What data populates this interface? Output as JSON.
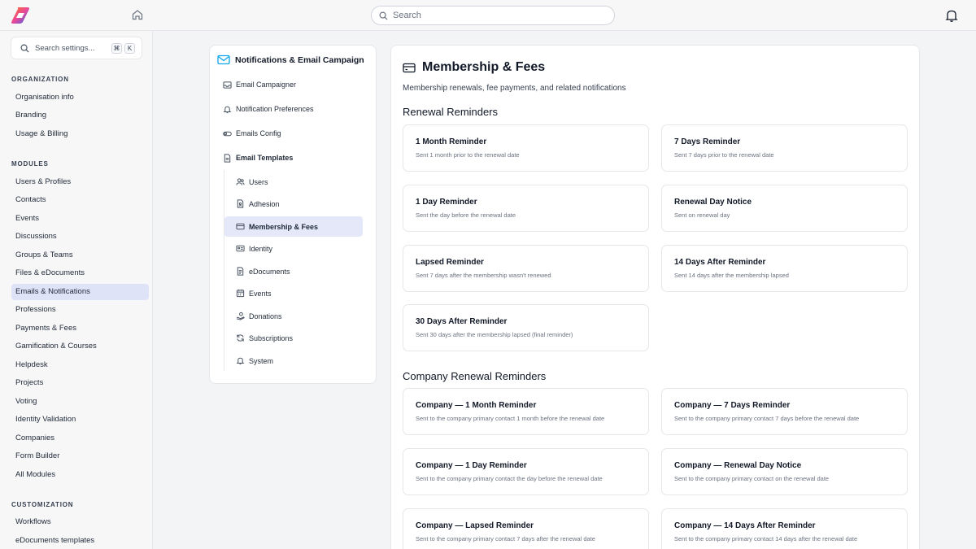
{
  "topbar": {
    "search_placeholder": "Search"
  },
  "sidebar": {
    "search_placeholder": "Search settings...",
    "shortcut_keys": [
      "⌘",
      "K"
    ],
    "sections": [
      {
        "title": "ORGANIZATION",
        "items": [
          {
            "label": "Organisation info"
          },
          {
            "label": "Branding"
          },
          {
            "label": "Usage & Billing"
          }
        ]
      },
      {
        "title": "MODULES",
        "items": [
          {
            "label": "Users & Profiles"
          },
          {
            "label": "Contacts"
          },
          {
            "label": "Events"
          },
          {
            "label": "Discussions"
          },
          {
            "label": "Groups & Teams"
          },
          {
            "label": "Files & eDocuments"
          },
          {
            "label": "Emails & Notifications"
          },
          {
            "label": "Professions"
          },
          {
            "label": "Payments & Fees"
          },
          {
            "label": "Gamification & Courses"
          },
          {
            "label": "Helpdesk"
          },
          {
            "label": "Projects"
          },
          {
            "label": "Voting"
          },
          {
            "label": "Identity Validation"
          },
          {
            "label": "Companies"
          },
          {
            "label": "Form Builder"
          },
          {
            "label": "All Modules"
          }
        ]
      },
      {
        "title": "CUSTOMIZATION",
        "items": [
          {
            "label": "Workflows"
          },
          {
            "label": "eDocuments templates"
          }
        ]
      }
    ],
    "active_item": "Emails & Notifications"
  },
  "subnav": {
    "title": "Notifications & Email Campaign",
    "items": [
      {
        "label": "Email Campaigner",
        "icon": "inbox-icon"
      },
      {
        "label": "Notification Preferences",
        "icon": "bell-icon"
      },
      {
        "label": "Emails Config",
        "icon": "toggle-icon"
      },
      {
        "label": "Email Templates",
        "icon": "file-icon"
      }
    ],
    "templates": [
      {
        "label": "Users",
        "icon": "users-icon"
      },
      {
        "label": "Adhesion",
        "icon": "file-user-icon"
      },
      {
        "label": "Membership & Fees",
        "icon": "credit-card-icon"
      },
      {
        "label": "Identity",
        "icon": "id-card-icon"
      },
      {
        "label": "eDocuments",
        "icon": "document-icon"
      },
      {
        "label": "Events",
        "icon": "calendar-icon"
      },
      {
        "label": "Donations",
        "icon": "hand-coins-icon"
      },
      {
        "label": "Subscriptions",
        "icon": "refresh-icon"
      },
      {
        "label": "System",
        "icon": "bell-icon"
      }
    ],
    "active_template": "Membership & Fees"
  },
  "content": {
    "title": "Membership & Fees",
    "description": "Membership renewals, fee payments, and related notifications",
    "groups": [
      {
        "title": "Renewal Reminders",
        "cards": [
          {
            "title": "1 Month Reminder",
            "desc": "Sent 1 month prior to the renewal date"
          },
          {
            "title": "7 Days Reminder",
            "desc": "Sent 7 days prior to the renewal date"
          },
          {
            "title": "1 Day Reminder",
            "desc": "Sent the day before the renewal date"
          },
          {
            "title": "Renewal Day Notice",
            "desc": "Sent on renewal day"
          },
          {
            "title": "Lapsed Reminder",
            "desc": "Sent 7 days after the membership wasn't renewed"
          },
          {
            "title": "14 Days After Reminder",
            "desc": "Sent 14 days after the membership lapsed"
          },
          {
            "title": "30 Days After Reminder",
            "desc": "Sent 30 days after the membership lapsed (final reminder)"
          }
        ]
      },
      {
        "title": "Company Renewal Reminders",
        "cards": [
          {
            "title": "Company — 1 Month Reminder",
            "desc": "Sent to the company primary contact 1 month before the renewal date"
          },
          {
            "title": "Company — 7 Days Reminder",
            "desc": "Sent to the company primary contact 7 days before the renewal date"
          },
          {
            "title": "Company — 1 Day Reminder",
            "desc": "Sent to the company primary contact the day before the renewal date"
          },
          {
            "title": "Company — Renewal Day Notice",
            "desc": "Sent to the company primary contact on the renewal date"
          },
          {
            "title": "Company — Lapsed Reminder",
            "desc": "Sent to the company primary contact 7 days after the renewal date"
          },
          {
            "title": "Company — 14 Days After Reminder",
            "desc": "Sent to the company primary contact 14 days after the renewal date"
          }
        ]
      }
    ]
  },
  "colors": {
    "brand_orange": "#f97316",
    "brand_blue": "#2563eb",
    "active_nav_bg": "#dfe3f8",
    "page_bg": "#f3f4f6"
  }
}
